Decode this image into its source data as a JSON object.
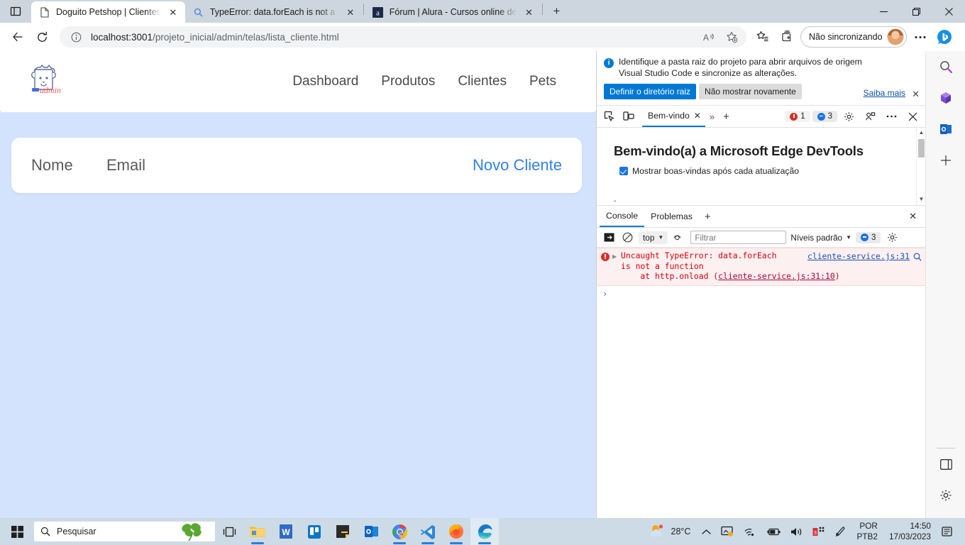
{
  "browser": {
    "tabs": [
      {
        "title": "Doguito Petshop | Clientes",
        "favicon": "page-icon",
        "active": true
      },
      {
        "title": "TypeError: data.forEach is not a f...",
        "favicon": "search-icon",
        "active": false
      },
      {
        "title": "Fórum | Alura - Cursos online de",
        "favicon": "alura-icon",
        "active": false
      }
    ],
    "new_tab_label": "+",
    "window_controls": {
      "minimize": "—",
      "restore": "❐",
      "close": "✕"
    },
    "address": {
      "url_host": "localhost:3001",
      "url_path": "/projeto_inicial/admin/telas/lista_cliente.html",
      "full_url": "localhost:3001/projeto_inicial/admin/telas/lista_cliente.html"
    },
    "profile_label": "Não sincronizando",
    "back_label": "←",
    "reload_label": "⟳"
  },
  "page": {
    "nav_links": [
      "Dashboard",
      "Produtos",
      "Clientes",
      "Pets"
    ],
    "logo_alt": "Doguito Admin",
    "card": {
      "col_nome": "Nome",
      "col_email": "Email",
      "novo_cliente": "Novo Cliente"
    }
  },
  "devtools": {
    "banner": {
      "line1": "Identifique a pasta raiz do projeto para abrir arquivos de origem",
      "line2": "Visual Studio Code e sincronize as alterações.",
      "primary_button": "Definir o diretório raiz",
      "secondary_button": "Não mostrar novamente",
      "learn_more": "Saiba mais",
      "close": "✕"
    },
    "tabbar": {
      "tab_label": "Bem-vindo",
      "tab_close": "✕",
      "more": "»",
      "add": "+",
      "error_count": "1",
      "message_count": "3",
      "close": "✕"
    },
    "welcome": {
      "title": "Bem-vindo(a) a Microsoft Edge DevTools",
      "checkbox_label": "Mostrar boas-vindas após cada atualização"
    },
    "console": {
      "tabs": [
        "Console",
        "Problemas"
      ],
      "active_tab": "Console",
      "add": "+",
      "close": "✕",
      "context": "top",
      "filter_placeholder": "Filtrar",
      "levels_label": "Níveis padrão",
      "message_count": "3",
      "error": {
        "line1": "Uncaught TypeError: data.forEach",
        "line2": "is not a function",
        "line3_prefix": "    at http.onload (",
        "line3_link": "cliente-service.js:31:10",
        "line3_suffix": ")",
        "source": "cliente-service.js:31"
      },
      "prompt": "›"
    }
  },
  "taskbar": {
    "search_placeholder": "Pesquisar",
    "temperature": "28°C",
    "language_line1": "POR",
    "language_line2": "PTB2",
    "time": "14:50",
    "date": "17/03/2023",
    "apps": [
      "task-view",
      "file-explorer",
      "word",
      "trello",
      "sticky-notes",
      "outlook",
      "chrome",
      "vscode",
      "firefox",
      "edge"
    ]
  },
  "colors": {
    "accent": "#0078d4",
    "page_bg": "#d3e3fd",
    "link": "#2f80ed",
    "error": "#d93025",
    "taskbar": "#cddbe6"
  }
}
